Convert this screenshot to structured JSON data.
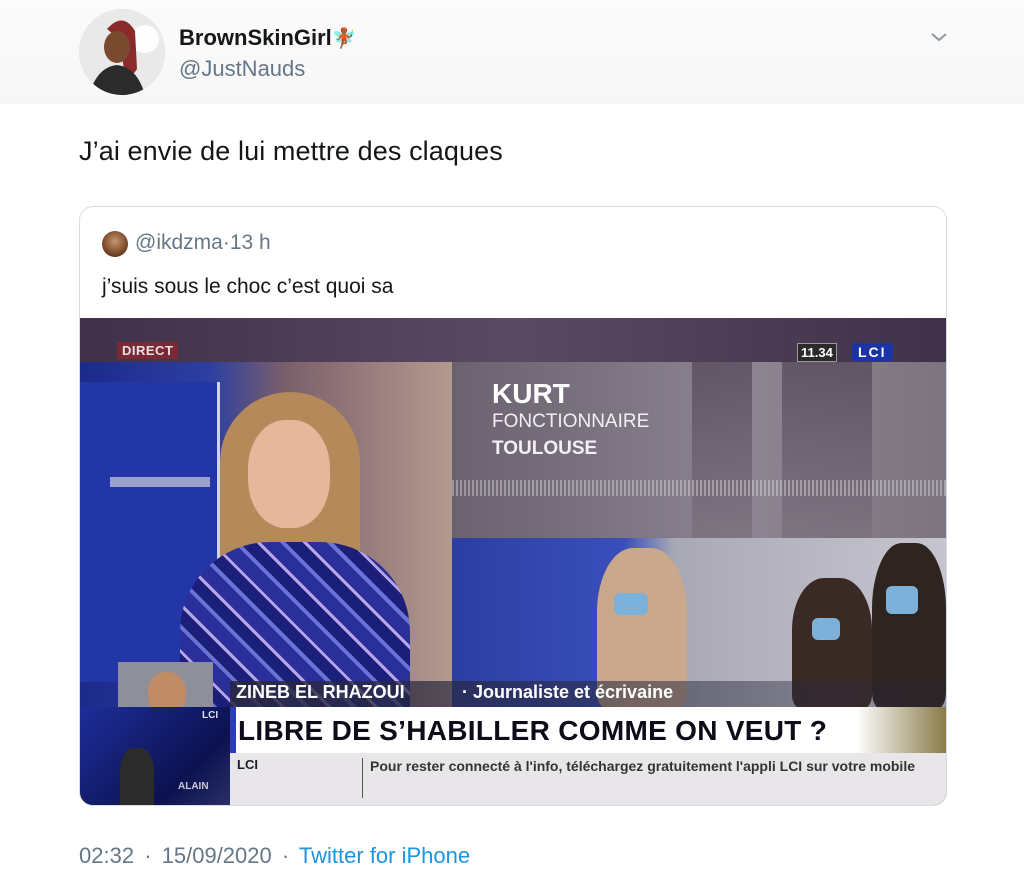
{
  "author": {
    "display_name": "BrownSkinGirl",
    "name_emoji": "🧚🏾",
    "handle": "@JustNauds"
  },
  "tweet": {
    "text": "J’ai envie de lui mettre des claques"
  },
  "quoted_tweet": {
    "handle": "@ikdzma",
    "separator": "·",
    "age": "13 h",
    "text": "j’suis sous le choc c’est quoi sa"
  },
  "video": {
    "direct_label": "DIRECT",
    "clock": "11.34",
    "channel": "LCI",
    "caller": {
      "name": "KURT",
      "job": "FONCTIONNAIRE",
      "city": "TOULOUSE"
    },
    "guest": {
      "name": "ZINEB EL RHAZOUI",
      "title": "· Journaliste et écrivaine"
    },
    "headline": "LIBRE DE S’HABILLER COMME ON VEUT ?",
    "ticker": {
      "label": "LCI",
      "text": "Pour rester connecté à l'info, téléchargez gratuitement l'appli LCI sur votre mobile"
    },
    "promo": {
      "label": "LCI",
      "name": "ALAIN"
    }
  },
  "footer": {
    "time": "02:32",
    "date": "15/09/2020",
    "separator": "·",
    "source": "Twitter for iPhone"
  },
  "colors": {
    "link": "#1b95e0",
    "muted": "#657786",
    "text": "#14171a",
    "border": "#d8dde2",
    "lci_blue": "#1c33a5"
  },
  "icons": {
    "menu": "chevron-down-icon"
  }
}
